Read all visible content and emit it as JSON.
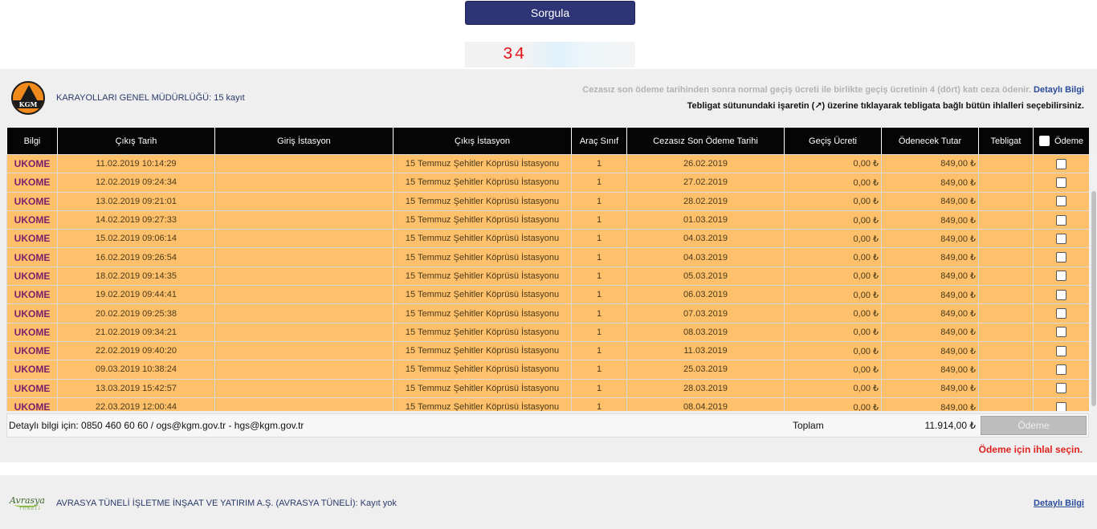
{
  "query": {
    "button_label": "Sorgula",
    "captcha_text": "34"
  },
  "kgm": {
    "logo_text": "KGM",
    "title": "KARAYOLLARI GENEL MÜDÜRLÜĞÜ:",
    "count_text": "15 kayıt",
    "notice_penalty": "Cezasız son ödeme tarihinden sonra normal geçiş ücreti ile birlikte geçiş ücretinin 4 (dört) katı ceza ödenir.",
    "detail_link": "Detaylı Bilgi",
    "notice_tebligat": "Tebligat sütunundaki işaretin (↗) üzerine tıklayarak tebligata bağlı bütün ihlalleri seçebilirsiniz."
  },
  "table": {
    "headers": [
      "Bilgi",
      "Çıkış Tarih",
      "Giriş İstasyon",
      "Çıkış İstasyon",
      "Araç Sınıf",
      "Cezasız Son Ödeme Tarihi",
      "Geçiş Ücreti",
      "Ödenecek Tutar",
      "Tebligat",
      "Ödeme"
    ],
    "rows": [
      {
        "bilgi": "UKOME",
        "cikis_tarih": "11.02.2019 10:14:29",
        "giris": "",
        "cikis_istasyon": "15 Temmuz Şehitler Köprüsü İstasyonu",
        "sinif": "1",
        "son_odeme": "26.02.2019",
        "gecis": "0,00 ₺",
        "tutar": "849,00 ₺",
        "tebligat": ""
      },
      {
        "bilgi": "UKOME",
        "cikis_tarih": "12.02.2019 09:24:34",
        "giris": "",
        "cikis_istasyon": "15 Temmuz Şehitler Köprüsü İstasyonu",
        "sinif": "1",
        "son_odeme": "27.02.2019",
        "gecis": "0,00 ₺",
        "tutar": "849,00 ₺",
        "tebligat": ""
      },
      {
        "bilgi": "UKOME",
        "cikis_tarih": "13.02.2019 09:21:01",
        "giris": "",
        "cikis_istasyon": "15 Temmuz Şehitler Köprüsü İstasyonu",
        "sinif": "1",
        "son_odeme": "28.02.2019",
        "gecis": "0,00 ₺",
        "tutar": "849,00 ₺",
        "tebligat": ""
      },
      {
        "bilgi": "UKOME",
        "cikis_tarih": "14.02.2019 09:27:33",
        "giris": "",
        "cikis_istasyon": "15 Temmuz Şehitler Köprüsü İstasyonu",
        "sinif": "1",
        "son_odeme": "01.03.2019",
        "gecis": "0,00 ₺",
        "tutar": "849,00 ₺",
        "tebligat": ""
      },
      {
        "bilgi": "UKOME",
        "cikis_tarih": "15.02.2019 09:06:14",
        "giris": "",
        "cikis_istasyon": "15 Temmuz Şehitler Köprüsü İstasyonu",
        "sinif": "1",
        "son_odeme": "04.03.2019",
        "gecis": "0,00 ₺",
        "tutar": "849,00 ₺",
        "tebligat": ""
      },
      {
        "bilgi": "UKOME",
        "cikis_tarih": "16.02.2019 09:26:54",
        "giris": "",
        "cikis_istasyon": "15 Temmuz Şehitler Köprüsü İstasyonu",
        "sinif": "1",
        "son_odeme": "04.03.2019",
        "gecis": "0,00 ₺",
        "tutar": "849,00 ₺",
        "tebligat": ""
      },
      {
        "bilgi": "UKOME",
        "cikis_tarih": "18.02.2019 09:14:35",
        "giris": "",
        "cikis_istasyon": "15 Temmuz Şehitler Köprüsü İstasyonu",
        "sinif": "1",
        "son_odeme": "05.03.2019",
        "gecis": "0,00 ₺",
        "tutar": "849,00 ₺",
        "tebligat": ""
      },
      {
        "bilgi": "UKOME",
        "cikis_tarih": "19.02.2019 09:44:41",
        "giris": "",
        "cikis_istasyon": "15 Temmuz Şehitler Köprüsü İstasyonu",
        "sinif": "1",
        "son_odeme": "06.03.2019",
        "gecis": "0,00 ₺",
        "tutar": "849,00 ₺",
        "tebligat": ""
      },
      {
        "bilgi": "UKOME",
        "cikis_tarih": "20.02.2019 09:25:38",
        "giris": "",
        "cikis_istasyon": "15 Temmuz Şehitler Köprüsü İstasyonu",
        "sinif": "1",
        "son_odeme": "07.03.2019",
        "gecis": "0,00 ₺",
        "tutar": "849,00 ₺",
        "tebligat": ""
      },
      {
        "bilgi": "UKOME",
        "cikis_tarih": "21.02.2019 09:34:21",
        "giris": "",
        "cikis_istasyon": "15 Temmuz Şehitler Köprüsü İstasyonu",
        "sinif": "1",
        "son_odeme": "08.03.2019",
        "gecis": "0,00 ₺",
        "tutar": "849,00 ₺",
        "tebligat": ""
      },
      {
        "bilgi": "UKOME",
        "cikis_tarih": "22.02.2019 09:40:20",
        "giris": "",
        "cikis_istasyon": "15 Temmuz Şehitler Köprüsü İstasyonu",
        "sinif": "1",
        "son_odeme": "11.03.2019",
        "gecis": "0,00 ₺",
        "tutar": "849,00 ₺",
        "tebligat": ""
      },
      {
        "bilgi": "UKOME",
        "cikis_tarih": "09.03.2019 10:38:24",
        "giris": "",
        "cikis_istasyon": "15 Temmuz Şehitler Köprüsü İstasyonu",
        "sinif": "1",
        "son_odeme": "25.03.2019",
        "gecis": "0,00 ₺",
        "tutar": "849,00 ₺",
        "tebligat": ""
      },
      {
        "bilgi": "UKOME",
        "cikis_tarih": "13.03.2019 15:42:57",
        "giris": "",
        "cikis_istasyon": "15 Temmuz Şehitler Köprüsü İstasyonu",
        "sinif": "1",
        "son_odeme": "28.03.2019",
        "gecis": "0,00 ₺",
        "tutar": "849,00 ₺",
        "tebligat": ""
      },
      {
        "bilgi": "UKOME",
        "cikis_tarih": "22.03.2019 12:00:44",
        "giris": "",
        "cikis_istasyon": "15 Temmuz Şehitler Köprüsü İstasyonu",
        "sinif": "1",
        "son_odeme": "08.04.2019",
        "gecis": "0,00 ₺",
        "tutar": "849,00 ₺",
        "tebligat": ""
      }
    ]
  },
  "footer": {
    "contact": "Detaylı bilgi için: 0850 460 60 60 / ogs@kgm.gov.tr - hgs@kgm.gov.tr",
    "total_label": "Toplam",
    "total_value": "11.914,00 ₺",
    "pay_button": "Ödeme",
    "pay_warning": "Ödeme için ihlal seçin."
  },
  "avrasya": {
    "logo_text": "Avrasya",
    "logo_sub": "TÜNELİ",
    "title": "AVRASYA TÜNELİ İŞLETME İNŞAAT VE YATIRIM A.Ş. (AVRASYA TÜNELİ):",
    "count_text": "Kayıt yok",
    "detail_link": "Detaylı Bilgi"
  },
  "colors": {
    "header_bg": "#050505",
    "row_bg": "#fec06b",
    "button_bg": "#2e3576",
    "warning": "#e0221e",
    "link": "#2b4c9b"
  }
}
